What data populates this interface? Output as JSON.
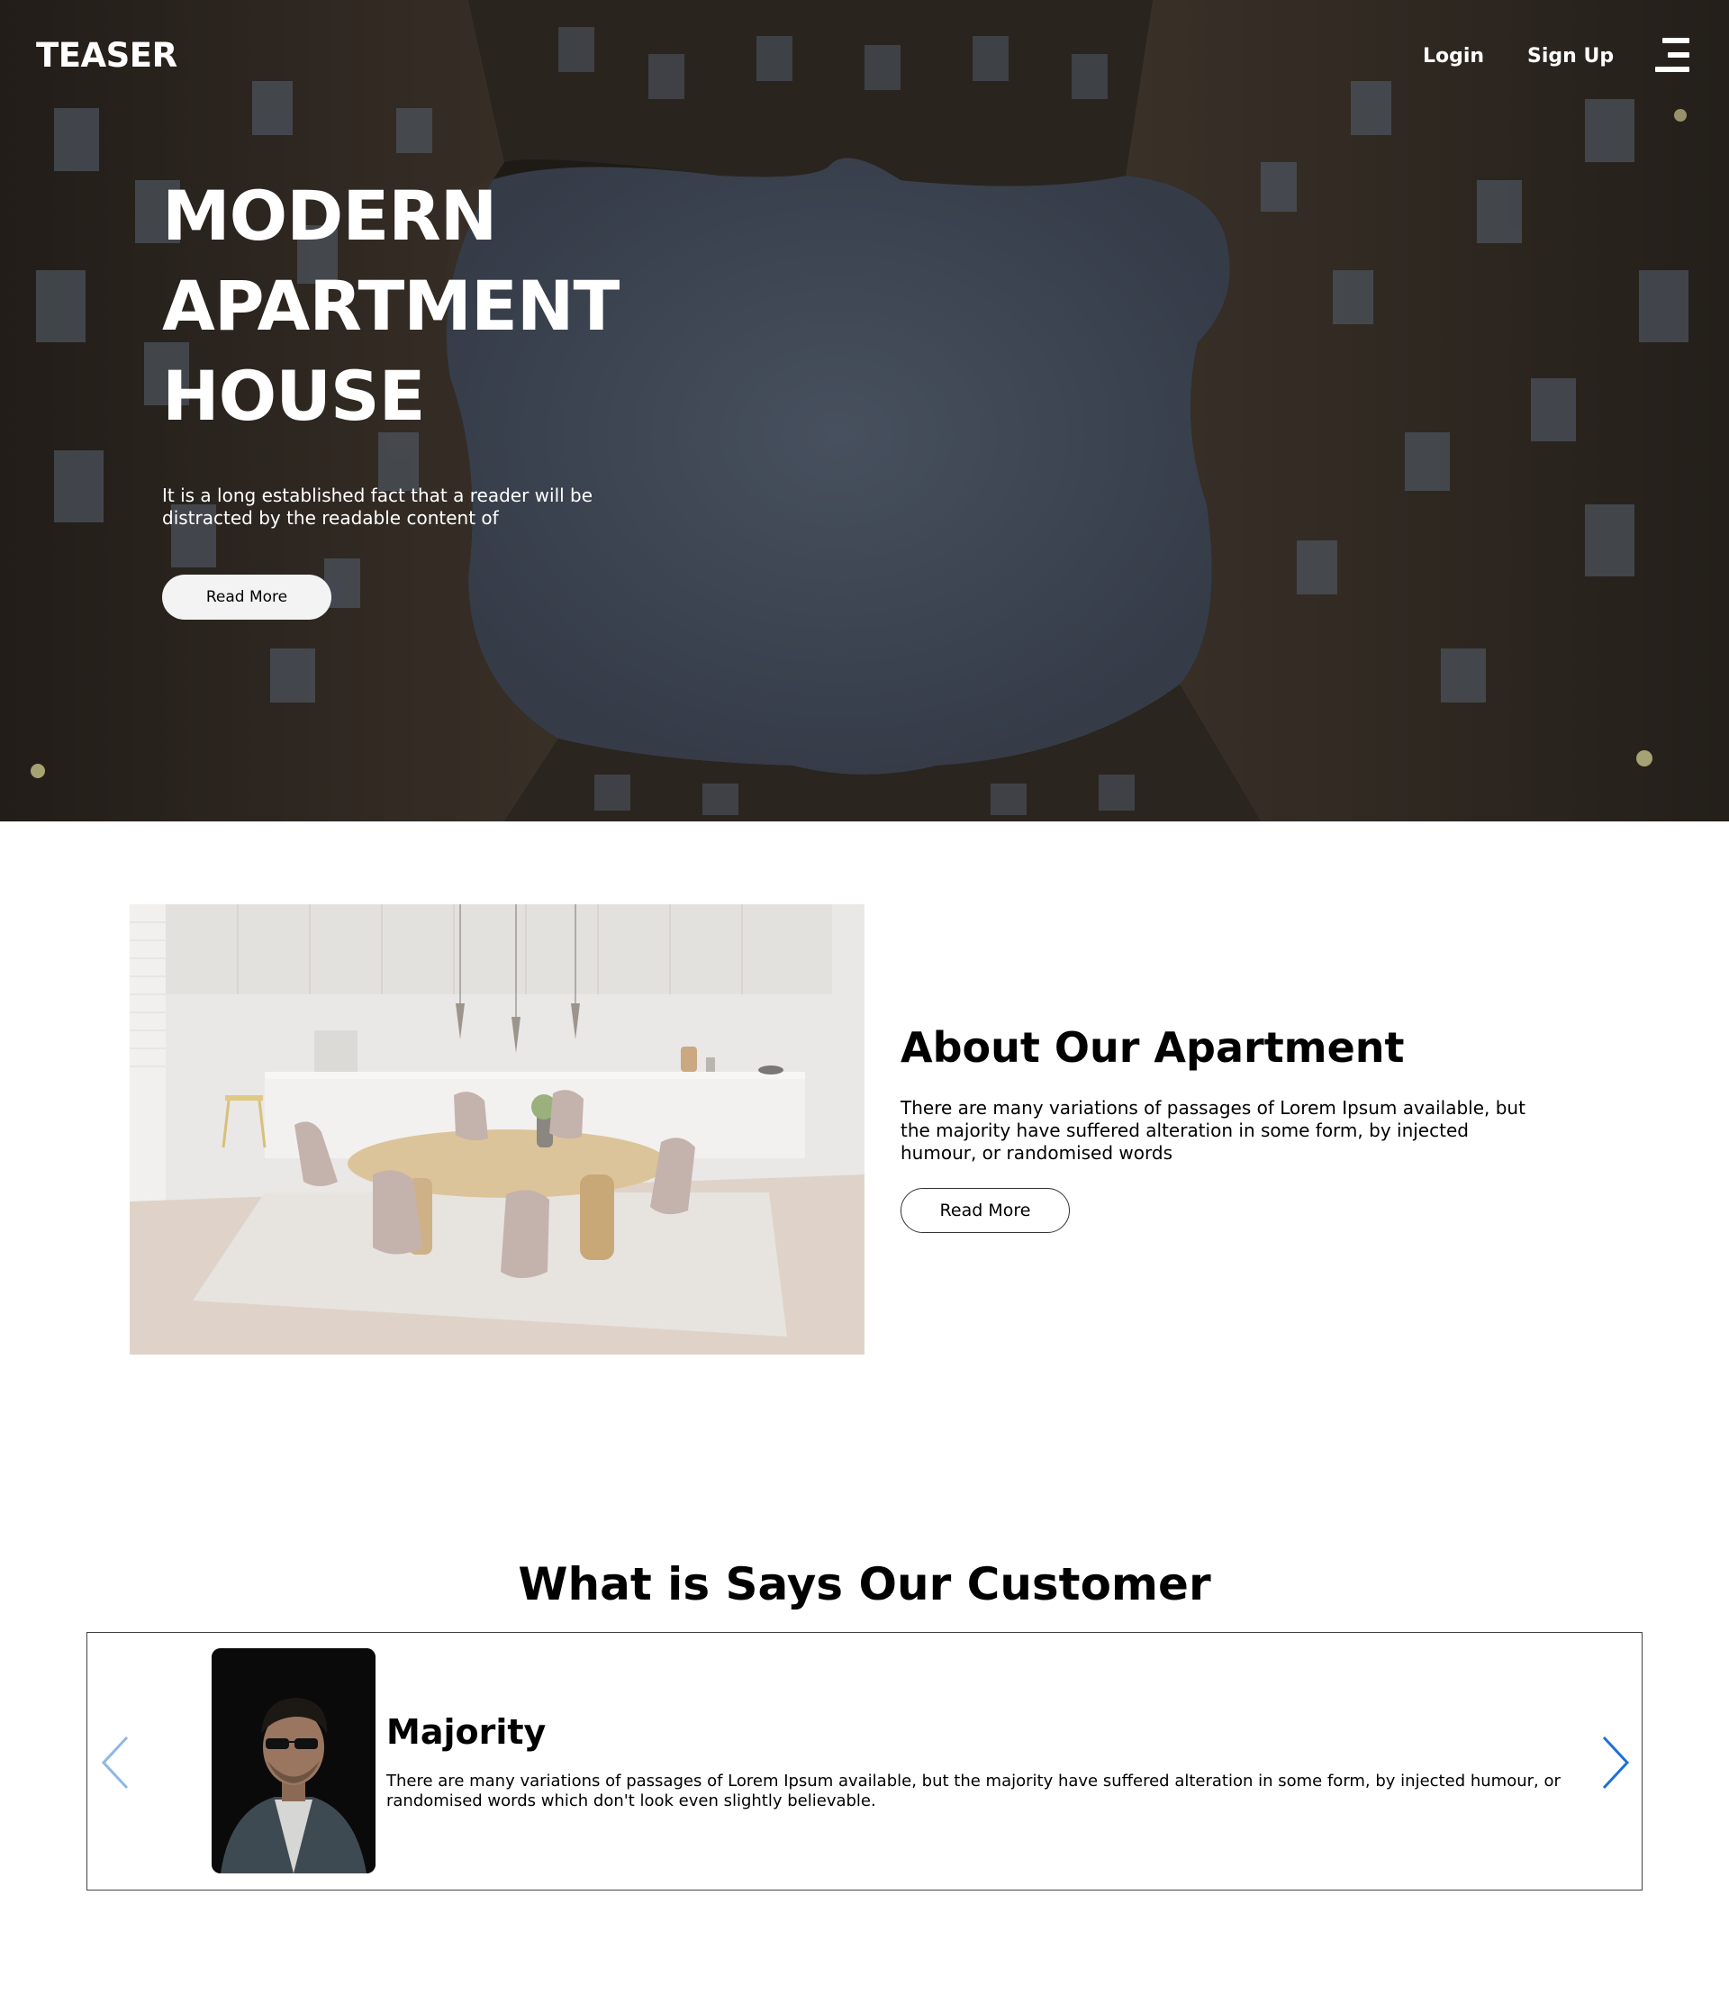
{
  "header": {
    "logo": "TEASER",
    "nav": {
      "login": "Login",
      "signup": "Sign Up"
    },
    "menu_icon": "hamburger-menu-icon"
  },
  "hero": {
    "title_lines": [
      "MODERN",
      "APARTMENT",
      "HOUSE"
    ],
    "description": "It is a long established fact that a reader will be distracted by the readable content of",
    "button_label": "Read More"
  },
  "about": {
    "title": "About Our Apartment",
    "text": "There are many variations of passages of Lorem Ipsum available, but the majority have suffered alteration in some form, by injected humour, or randomised words",
    "button_label": "Read More"
  },
  "testimonials": {
    "heading": "What is Says Our Customer",
    "items": [
      {
        "name": "Majority",
        "text": "There are many variations of passages of Lorem Ipsum available, but the majority have suffered alteration in some form, by injected humour, or randomised words which don't look even slightly believable."
      }
    ],
    "prev_icon": "chevron-left-icon",
    "next_icon": "chevron-right-icon"
  },
  "colors": {
    "hero_overlay": "#1a1714",
    "sky": "#3d4552",
    "arrow_active": "#1e6fd9",
    "arrow_inactive": "#8fb6e8",
    "button_light": "#f3f3f3"
  }
}
